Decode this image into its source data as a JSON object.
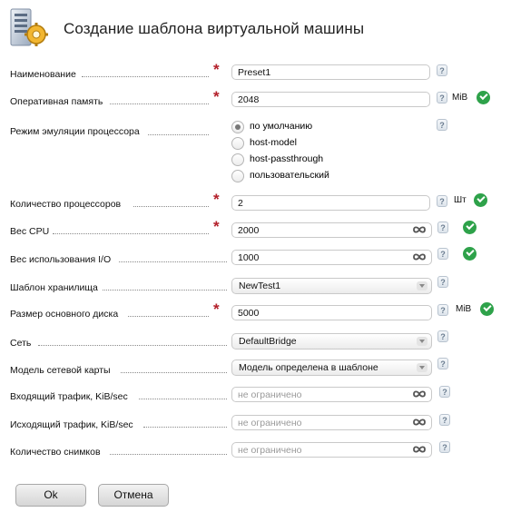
{
  "dialog": {
    "title": "Создание шаблона виртуальной машины",
    "logo_icon": "server-gear-icon"
  },
  "fields": {
    "name": {
      "label": "Наименование",
      "value": "Preset1",
      "required": true
    },
    "ram": {
      "label": "Оперативная память",
      "value": "2048",
      "unit": "MiB",
      "required": true,
      "valid": true
    },
    "cpu_mode": {
      "label": "Режим эмуляции процессора",
      "options": [
        "по умолчанию",
        "host-model",
        "host-passthrough",
        "пользовательский"
      ],
      "selected": "по умолчанию"
    },
    "cpu_count": {
      "label": "Количество процессоров",
      "value": "2",
      "unit": "Шт",
      "required": true,
      "valid": true
    },
    "cpu_weight": {
      "label": "Вес CPU",
      "value": "2000",
      "required": true,
      "valid": true
    },
    "io_weight": {
      "label": "Вес использования I/O",
      "value": "1000",
      "valid": true
    },
    "storage_template": {
      "label": "Шаблон хранилища",
      "value": "NewTest1"
    },
    "disk_size": {
      "label": "Размер основного диска",
      "value": "5000",
      "unit": "MiB",
      "required": true,
      "valid": true
    },
    "network": {
      "label": "Сеть",
      "value": "DefaultBridge"
    },
    "nic_model": {
      "label": "Модель сетевой карты",
      "value": "Модель определена в шаблоне"
    },
    "traffic_in": {
      "label": "Входящий трафик, KiB/sec",
      "placeholder": "не ограничено"
    },
    "traffic_out": {
      "label": "Исходящий трафик, KiB/sec",
      "placeholder": "не ограничено"
    },
    "snapshots": {
      "label": "Количество снимков",
      "placeholder": "не ограничено"
    }
  },
  "common": {
    "required_mark": "*",
    "help_mark": "?"
  },
  "buttons": {
    "ok": "Ok",
    "cancel": "Отмена"
  },
  "colors": {
    "required": "#b3202a",
    "valid": "#2ea24a",
    "infinity": "#555555"
  }
}
